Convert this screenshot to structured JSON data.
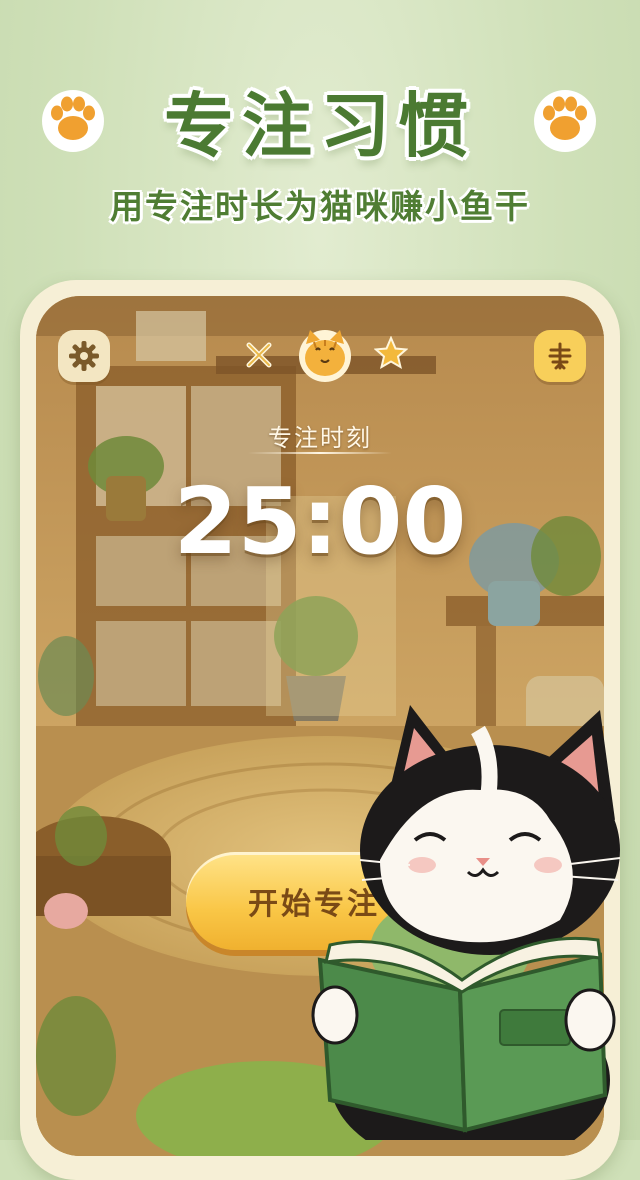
{
  "header": {
    "title": "专注习惯",
    "subtitle": "用专注时长为猫咪赚小鱼干"
  },
  "screen": {
    "focus_label": "专注时刻",
    "timer": "25:00",
    "start_button_label": "开始专注"
  },
  "icons": {
    "left_paw": "paw-icon",
    "right_paw": "paw-icon",
    "settings": "gear-icon",
    "menu": "fish-bone-icon",
    "cross_decoration": "cross-icon",
    "cat_face_badge": "cat-face-icon",
    "star_decoration": "star-icon"
  },
  "colors": {
    "background": "#cfe0b8",
    "headline": "#4b7a32",
    "button": "#f9c646",
    "button_text": "#7a4a16",
    "phone_frame": "#f6efd6"
  }
}
